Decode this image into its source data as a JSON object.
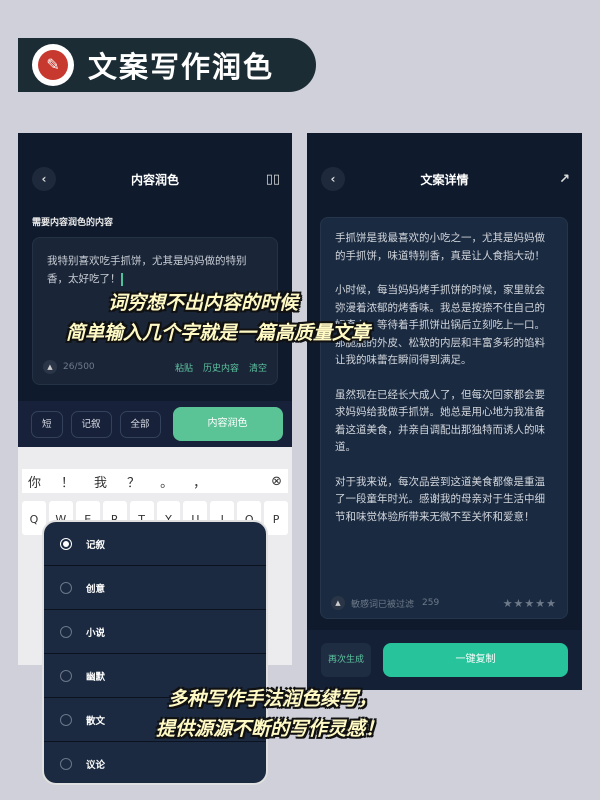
{
  "banner": {
    "title": "文案写作润色",
    "icon": "pencil-icon"
  },
  "left": {
    "title": "内容润色",
    "label": "需要内容润色的内容",
    "input": "我特别喜欢吃手抓饼，尤其是妈妈做的特别香，太好吃了！",
    "count": "26/500",
    "actions": [
      "粘贴",
      "历史内容",
      "清空"
    ],
    "chips": [
      "短",
      "记叙",
      "全部"
    ],
    "submit": "内容润色",
    "keyboard": {
      "candidates": [
        "你",
        "！",
        "我",
        "？",
        "。",
        "，"
      ],
      "keys": [
        "Q",
        "W",
        "E",
        "R",
        "T",
        "Y",
        "U",
        "I",
        "O",
        "P"
      ]
    }
  },
  "popup": {
    "options": [
      "记叙",
      "创意",
      "小说",
      "幽默",
      "散文",
      "议论"
    ],
    "selected": "记叙"
  },
  "right": {
    "title": "文案详情",
    "paragraphs": [
      "手抓饼是我最喜欢的小吃之一，尤其是妈妈做的手抓饼，味道特别香，真是让人食指大动！",
      "小时候，每当妈妈烤手抓饼的时候，家里就会弥漫着浓郁的烤香味。我总是按捺不住自己的好奇心，等待着手抓饼出锅后立刻吃上一口。那脆脆的外皮、松软的内层和丰富多彩的馅料让我的味蕾在瞬间得到满足。",
      "虽然现在已经长大成人了，但每次回家都会要求妈妈给我做手抓饼。她总是用心地为我准备着这道美食，并亲自调配出那独特而诱人的味道。",
      "对于我来说，每次品尝到这道美食都像是重温了一段童年时光。感谢我的母亲对于生活中细节和味觉体验所带来无微不至关怀和爱意！"
    ],
    "filter": "敏感词已被过滤",
    "count": "259",
    "rating": 0,
    "regen": "再次生成",
    "copy": "一键复制"
  },
  "captions": [
    "词穷想不出内容的时候",
    "简单输入几个字就是一篇高质量文章",
    "多种写作手法润色续写，",
    "提供源源不断的写作灵感！"
  ],
  "colors": {
    "accent": "#5bc497",
    "bg": "#0f1b2d"
  }
}
